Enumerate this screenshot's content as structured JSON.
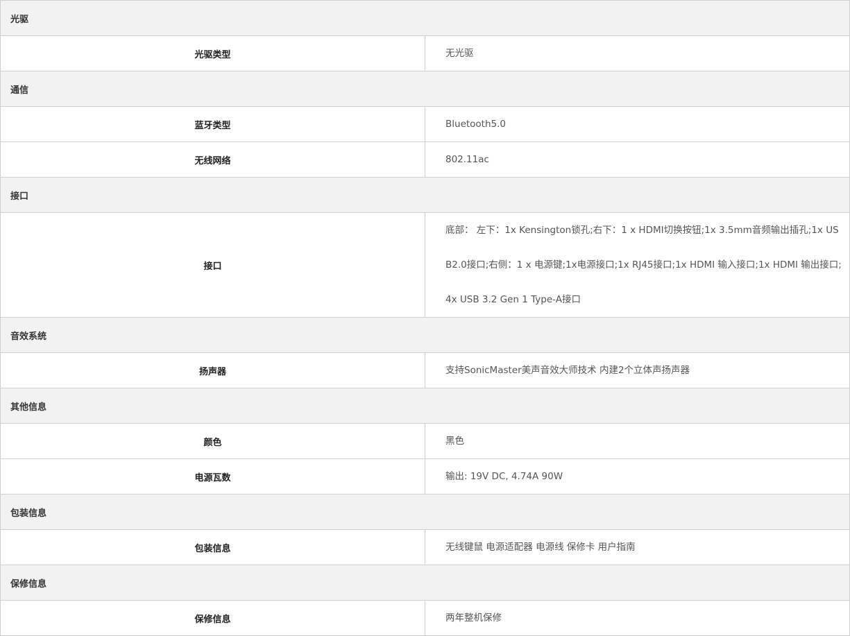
{
  "sections": [
    {
      "title": "光驱",
      "rows": [
        {
          "label": "光驱类型",
          "value": "无光驱"
        }
      ]
    },
    {
      "title": "通信",
      "rows": [
        {
          "label": "蓝牙类型",
          "value": "Bluetooth5.0"
        },
        {
          "label": "无线网络",
          "value": "802.11ac"
        }
      ]
    },
    {
      "title": "接口",
      "rows": [
        {
          "label": "接口",
          "value": "底部： 左下：1x Kensington锁孔;右下：1 x HDMI切换按钮;1x 3.5mm音频输出插孔;1x USB2.0接口;右侧：1 x 电源键;1x电源接口;1x RJ45接口;1x HDMI 输入接口;1x HDMI 输出接口;4x USB 3.2 Gen 1 Type-A接口"
        }
      ]
    },
    {
      "title": "音效系统",
      "rows": [
        {
          "label": "扬声器",
          "value": "支持SonicMaster美声音效大师技术 内建2个立体声扬声器"
        }
      ]
    },
    {
      "title": "其他信息",
      "rows": [
        {
          "label": "颜色",
          "value": "黑色"
        },
        {
          "label": "电源瓦数",
          "value": "输出: 19V DC, 4.74A 90W"
        }
      ]
    },
    {
      "title": "包装信息",
      "rows": [
        {
          "label": "包装信息",
          "value": "无线键鼠 电源适配器 电源线 保修卡 用户指南"
        }
      ]
    },
    {
      "title": "保修信息",
      "rows": [
        {
          "label": "保修信息",
          "value": "两年整机保修"
        }
      ]
    }
  ]
}
